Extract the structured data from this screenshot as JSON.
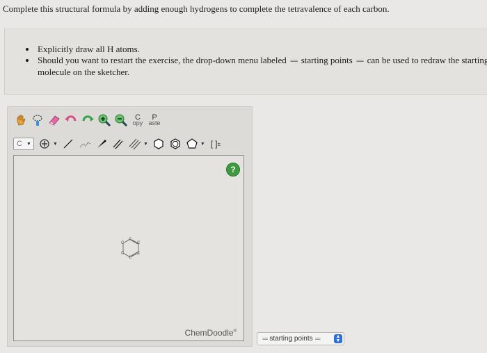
{
  "question": "Complete this structural formula by adding enough hydrogens to complete the tetravalence of each carbon.",
  "instructions": {
    "bullet1": "Explicitly draw all H atoms.",
    "bullet2_part1": "Should you want to restart the exercise, the drop-down menu labeled",
    "bullet2_label": "starting points",
    "bullet2_part2": "can be used to redraw the starting molecule on the sketcher.",
    "arrow_marker": "=="
  },
  "sketcher": {
    "copy_label_top": "C",
    "copy_label_bottom": "opy",
    "paste_label_top": "P",
    "paste_label_bottom": "aste",
    "element_select": "C",
    "bracket_label": "[ ]",
    "bracket_sup": "±",
    "help": "?",
    "brand": "ChemDoodle",
    "brand_mark": "®",
    "molecule_atoms": [
      "C",
      "C",
      "C",
      "C",
      "C",
      "C"
    ]
  },
  "starting_points": {
    "marker": "==",
    "label": "starting points"
  }
}
